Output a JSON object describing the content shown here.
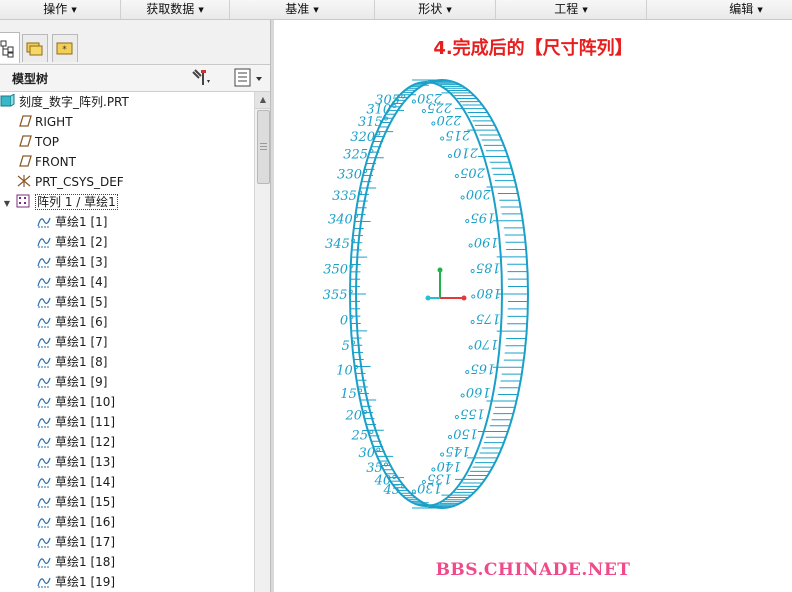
{
  "menu": {
    "items": [
      {
        "label": "操作"
      },
      {
        "label": "获取数据"
      },
      {
        "label": "基准"
      },
      {
        "label": "形状"
      },
      {
        "label": "工程"
      },
      {
        "label": "编辑"
      }
    ]
  },
  "panel": {
    "title": "模型树",
    "tabs": [
      "model-tree-tab",
      "folder-tab",
      "favorites-tab"
    ]
  },
  "tree": {
    "root": "刻度_数字_阵列.PRT",
    "features": [
      {
        "label": "RIGHT",
        "icon": "datum-plane-icon"
      },
      {
        "label": "TOP",
        "icon": "datum-plane-icon"
      },
      {
        "label": "FRONT",
        "icon": "datum-plane-icon"
      },
      {
        "label": "PRT_CSYS_DEF",
        "icon": "csys-icon"
      }
    ],
    "pattern": {
      "label": "阵列 1 / 草绘1",
      "expanded": true
    },
    "sketches": [
      "草绘1 [1]",
      "草绘1 [2]",
      "草绘1 [3]",
      "草绘1 [4]",
      "草绘1 [5]",
      "草绘1 [6]",
      "草绘1 [7]",
      "草绘1 [8]",
      "草绘1 [9]",
      "草绘1 [10]",
      "草绘1 [11]",
      "草绘1 [12]",
      "草绘1 [13]",
      "草绘1 [14]",
      "草绘1 [15]",
      "草绘1 [16]",
      "草绘1 [17]",
      "草绘1 [18]",
      "草绘1 [19]"
    ]
  },
  "viewport": {
    "caption": "4.完成后的【尺寸阵列】",
    "watermark": "BBS.CHINADE.NET",
    "dial_color": "#1aa0c8",
    "dial_labels_left": [
      "305°",
      "310°",
      "315°",
      "320°",
      "325°",
      "330°",
      "335°",
      "340°",
      "345°",
      "350°",
      "355°",
      "0°",
      "5°",
      "10°",
      "15°",
      "20°",
      "25°",
      "30°",
      "35°",
      "40°",
      "45°"
    ],
    "dial_labels_right": [
      "230°",
      "225°",
      "220°",
      "215°",
      "210°",
      "205°",
      "200°",
      "195°",
      "190°",
      "185°",
      "180°",
      "175°",
      "170°",
      "165°",
      "160°",
      "155°",
      "150°",
      "145°",
      "140°",
      "135°",
      "130°"
    ]
  }
}
